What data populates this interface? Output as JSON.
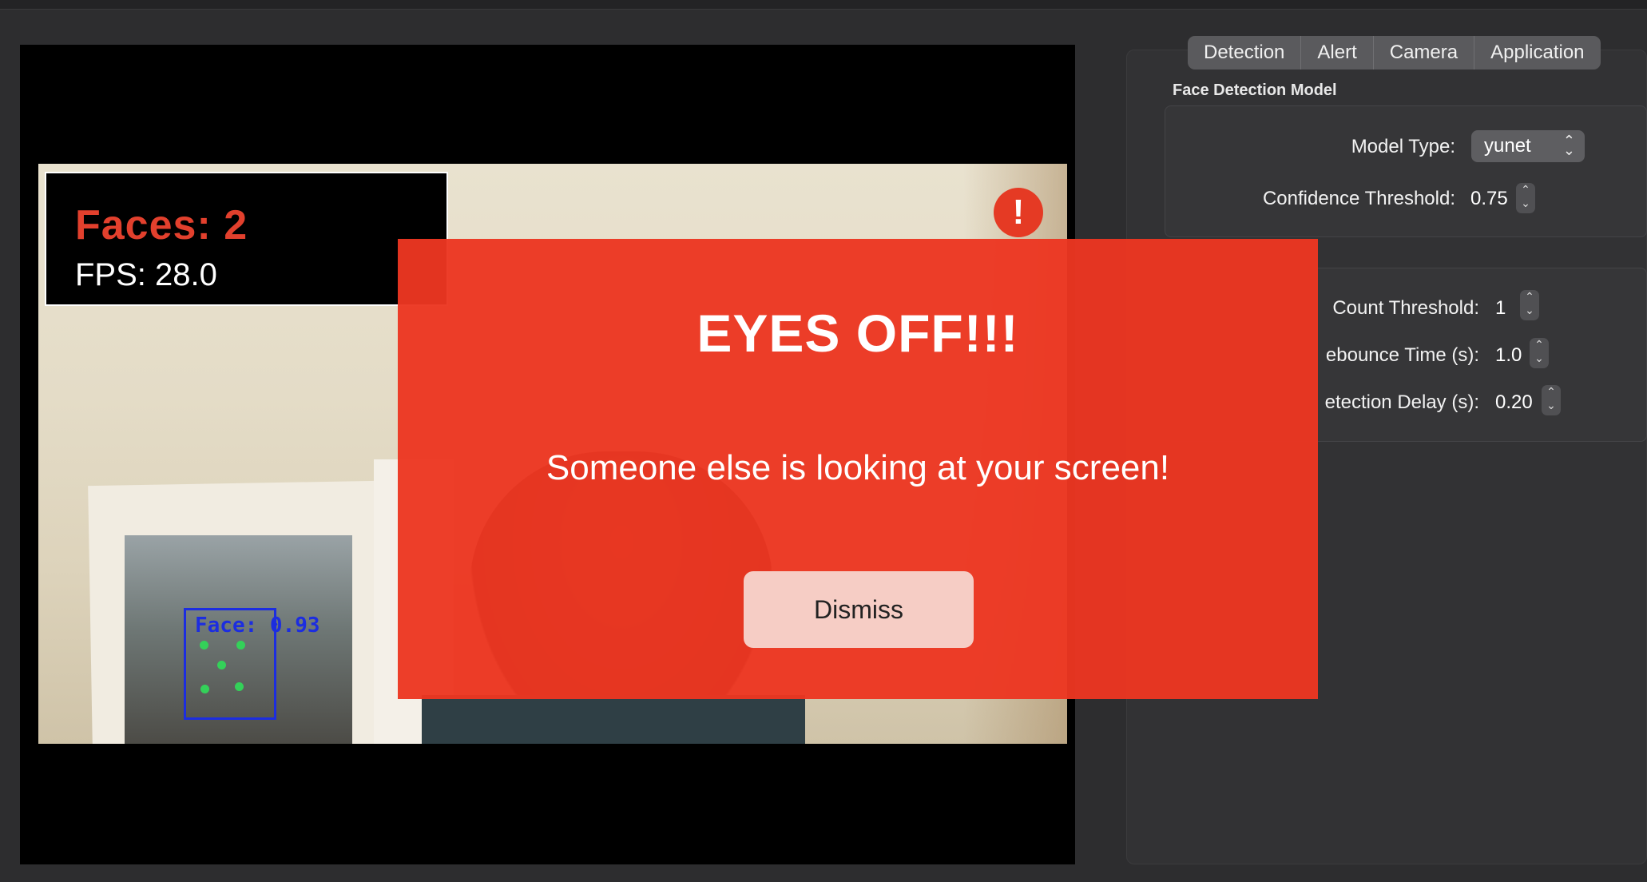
{
  "video": {
    "hud": {
      "faces_text": "Faces: 2",
      "fps_text": "FPS: 28.0"
    },
    "alert_badge": "!",
    "face_label": "Face: 0.93"
  },
  "tabs": [
    {
      "label": "Detection"
    },
    {
      "label": "Alert"
    },
    {
      "label": "Camera"
    },
    {
      "label": "Application"
    }
  ],
  "face_detection_model": {
    "title": "Face Detection Model",
    "model_type": {
      "label": "Model Type:",
      "value": "yunet"
    },
    "confidence_threshold": {
      "label": "Confidence Threshold:",
      "value": "0.75"
    }
  },
  "detection_settings": {
    "face_count_threshold": {
      "label": "Count Threshold:",
      "value": "1"
    },
    "debounce_time": {
      "label": "ebounce Time (s):",
      "value": "1.0"
    },
    "detection_delay": {
      "label": "etection Delay (s):",
      "value": "0.20"
    }
  },
  "modal": {
    "title": "EYES OFF!!!",
    "message": "Someone else is looking at your screen!",
    "dismiss_label": "Dismiss",
    "background_color": "#ec3621"
  },
  "colors": {
    "hud_faces": "#e2402d",
    "face_box": "#1c2de0",
    "landmark": "#34d159"
  }
}
